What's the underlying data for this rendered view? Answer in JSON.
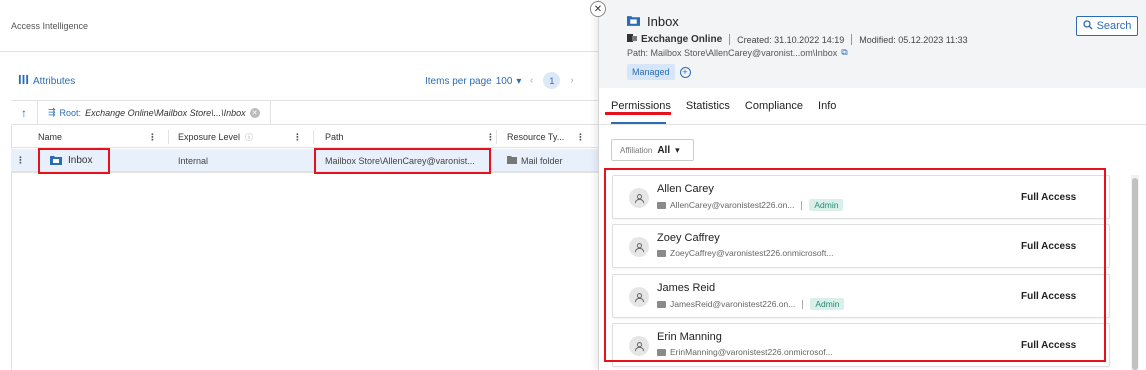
{
  "app": {
    "title": "Access Intelligence"
  },
  "toolbar": {
    "attributes_label": "Attributes",
    "items_per_page_label": "Items per page",
    "items_per_page_value": "100",
    "current_page": "1"
  },
  "breadcrumb": {
    "root_label": "Root:",
    "path": "Exchange Online\\Mailbox Store\\...\\Inbox"
  },
  "grid": {
    "columns": [
      "Name",
      "Exposure Level",
      "Path",
      "Resource Ty..."
    ],
    "rows": [
      {
        "name": "Inbox",
        "exposure": "Internal",
        "path": "Mailbox Store\\AllenCarey@varonist...",
        "resource_type": "Mail folder"
      }
    ]
  },
  "panel": {
    "title": "Inbox",
    "source": "Exchange Online",
    "created": "Created: 31.10.2022 14:19",
    "modified": "Modified: 05.12.2023 11:33",
    "path": "Path: Mailbox Store\\AllenCarey@varonist...om\\Inbox",
    "managed_badge": "Managed",
    "search_label": "Search",
    "tabs": [
      "Permissions",
      "Statistics",
      "Compliance",
      "Info"
    ],
    "affiliation_label": "Affiliation",
    "affiliation_value": "All",
    "permissions": [
      {
        "name": "Allen Carey",
        "email": "AllenCarey@varonistest226.on...",
        "role": "Admin",
        "access": "Full Access"
      },
      {
        "name": "Zoey Caffrey",
        "email": "ZoeyCaffrey@varonistest226.onmicrosoft...",
        "role": "",
        "access": "Full Access"
      },
      {
        "name": "James Reid",
        "email": "JamesReid@varonistest226.on...",
        "role": "Admin",
        "access": "Full Access"
      },
      {
        "name": "Erin Manning",
        "email": "ErinManning@varonistest226.onmicrosof...",
        "role": "",
        "access": "Full Access"
      }
    ]
  },
  "colors": {
    "accent": "#2a6db5",
    "highlight": "#e3121c",
    "row_selected": "#e8f0fb",
    "admin_badge": "#d9f0ea"
  }
}
